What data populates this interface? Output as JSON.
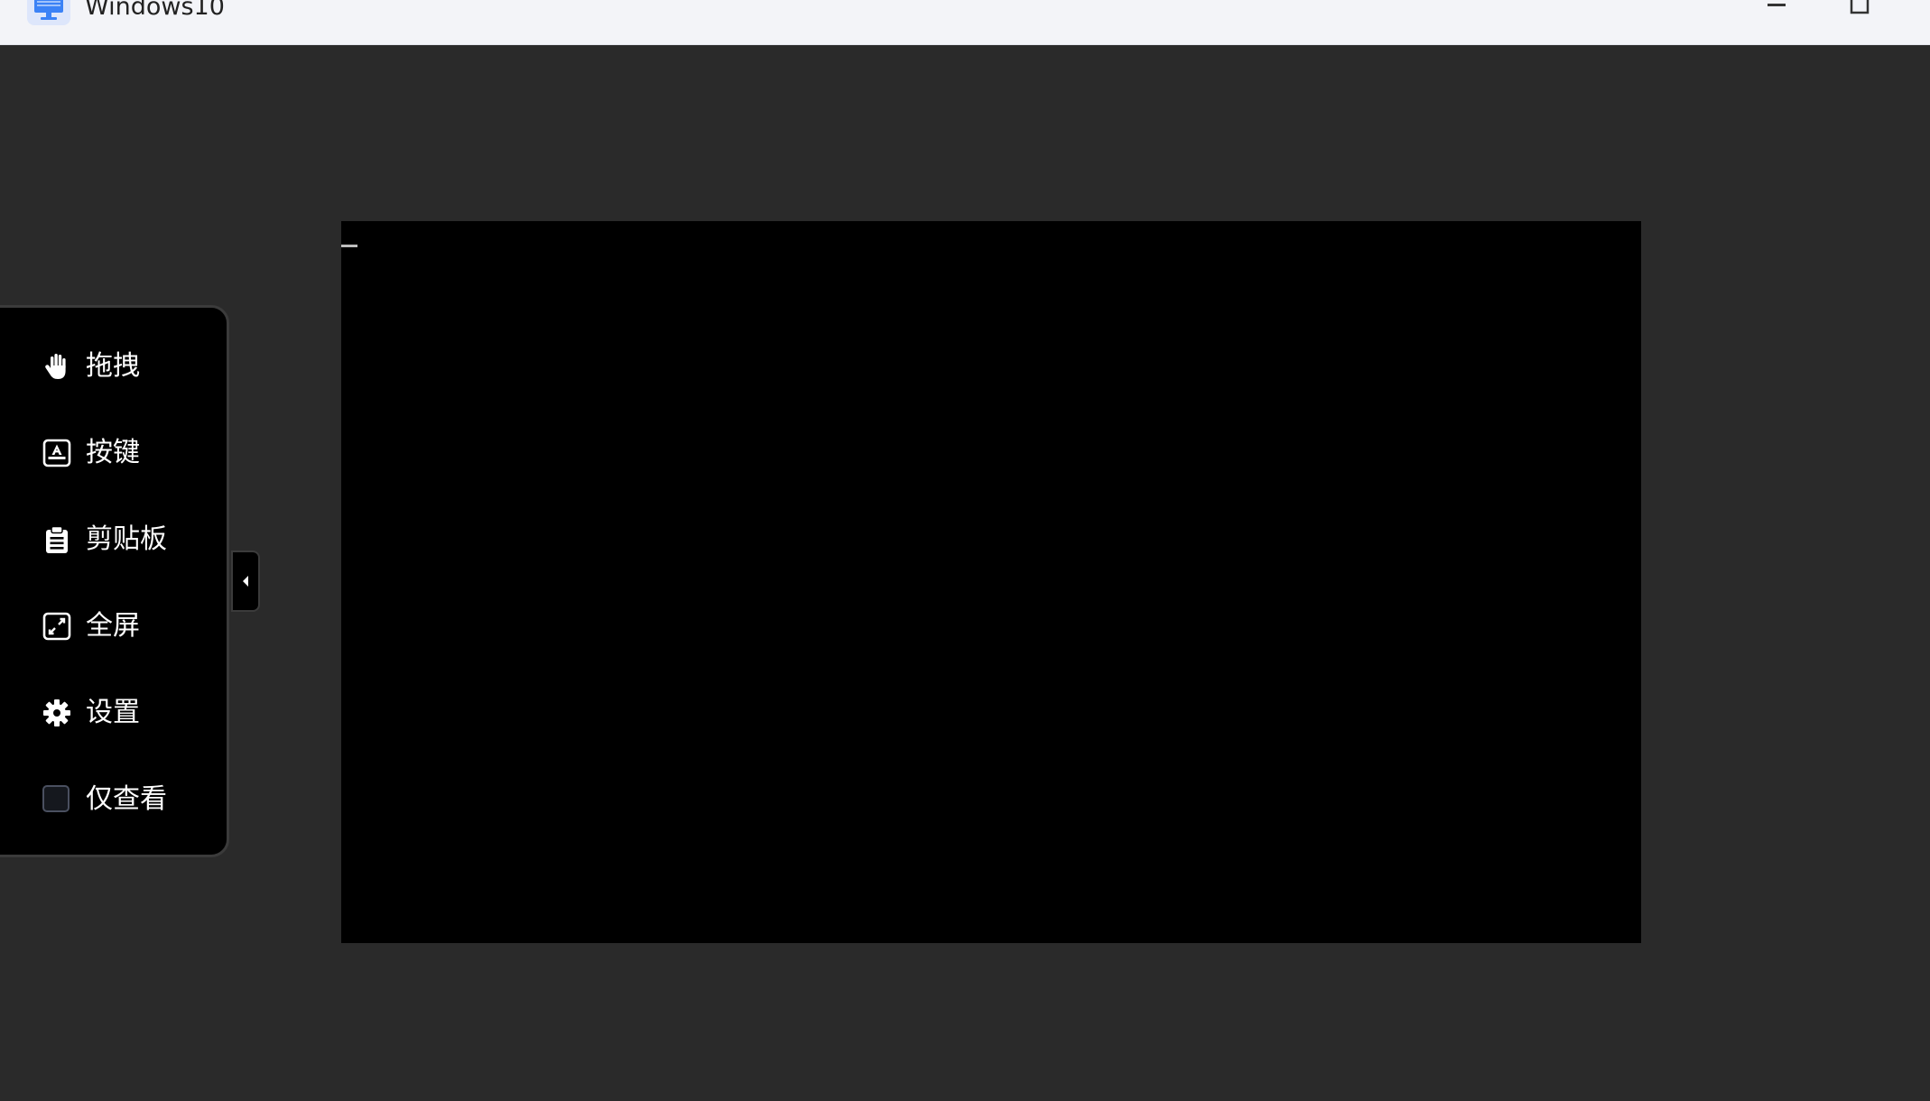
{
  "window": {
    "title": "Windows10",
    "controls": [
      "minimize",
      "maximize"
    ]
  },
  "toolbar": {
    "items": [
      {
        "label": "拖拽",
        "icon": "hand-icon"
      },
      {
        "label": "按键",
        "icon": "keyboard-key-icon"
      },
      {
        "label": "剪贴板",
        "icon": "clipboard-icon"
      },
      {
        "label": "全屏",
        "icon": "fullscreen-icon"
      },
      {
        "label": "设置",
        "icon": "gear-icon"
      },
      {
        "label": "仅查看",
        "icon": "checkbox",
        "checked": false
      }
    ],
    "collapse_icon": "caret-left-icon"
  },
  "colors": {
    "background": "#2a2a2a",
    "titlebar": "#f3f4f8",
    "remote_screen": "#000000",
    "toolbar_bg": "#000000",
    "toolbar_border": "#3b3b3b",
    "app_icon_accent": "#3b82f6"
  }
}
